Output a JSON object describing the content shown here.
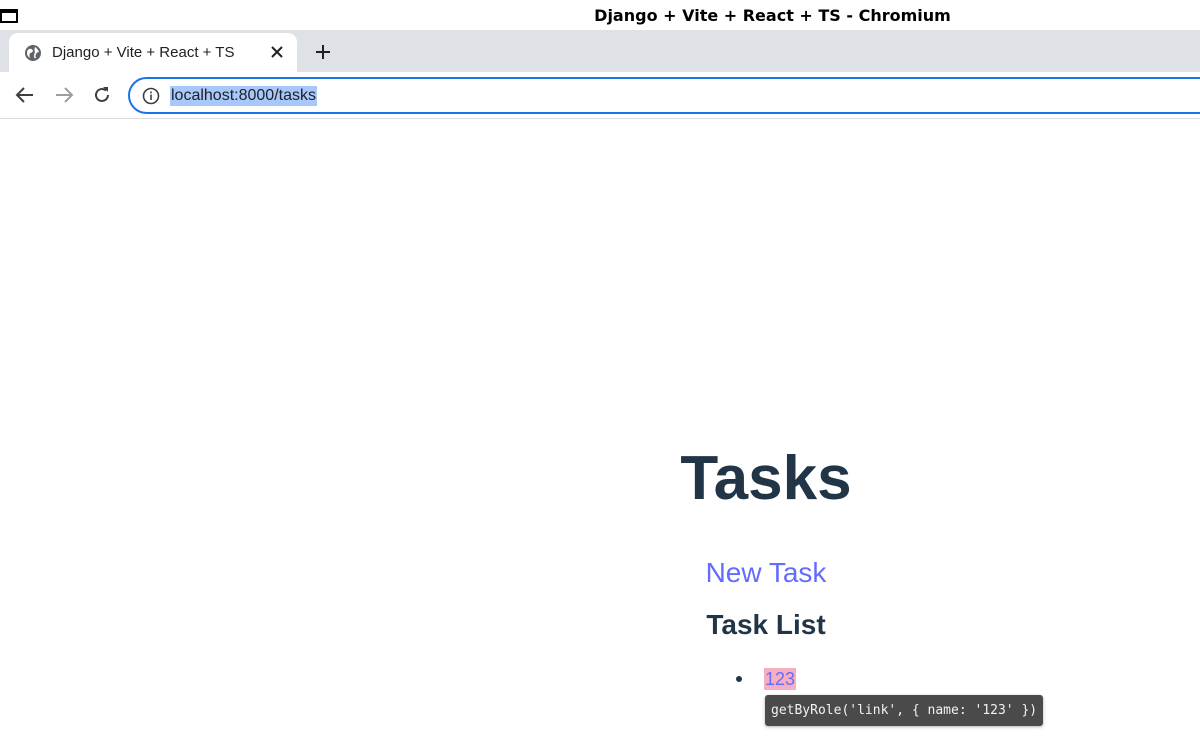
{
  "window": {
    "title": "Django + Vite + React + TS - Chromium"
  },
  "tabs": [
    {
      "title": "Django + Vite + React + TS",
      "favicon": "globe-icon",
      "active": true
    }
  ],
  "toolbar": {
    "url": "localhost:8000/tasks",
    "back_icon": "arrow-left-icon",
    "forward_icon": "arrow-right-icon",
    "reload_icon": "reload-icon",
    "info_icon": "info-icon"
  },
  "page": {
    "title": "Tasks",
    "new_task_link": "New Task",
    "section_title": "Task List",
    "tasks": [
      {
        "name": "123"
      }
    ],
    "locator_tooltip": "getByRole('link', { name: '123' })"
  },
  "colors": {
    "text": "#213547",
    "link": "#646cff",
    "omnibox_focus": "#1a73e8",
    "selection": "#a8c7fa",
    "highlight": "#f0a0b4"
  }
}
